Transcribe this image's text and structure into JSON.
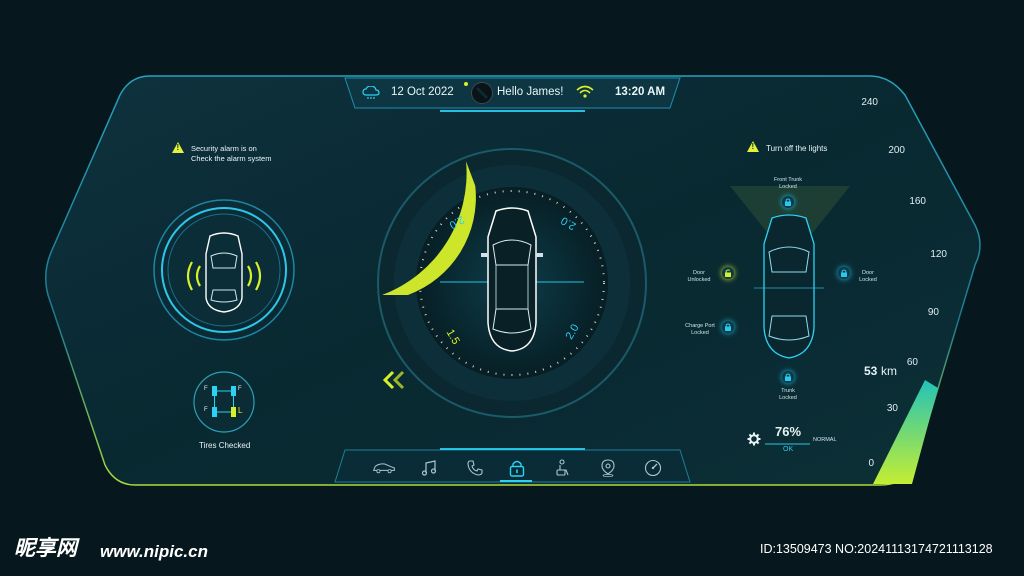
{
  "header": {
    "date": "12 Oct 2022",
    "greeting": "Hello James!",
    "time": "13:20 AM"
  },
  "left_panel": {
    "alarm_line1": "Security alarm is on",
    "alarm_line2": "Check the alarm system",
    "tires_status": "Tires Checked",
    "tire_labels": [
      "F",
      "F",
      "F",
      "L"
    ]
  },
  "center_gauge": {
    "pressure_values": [
      "2.0",
      "2.0",
      "1.5",
      "2.0"
    ],
    "level": 0.35
  },
  "right_panel": {
    "lights_warning": "Turn off the lights",
    "front_trunk": {
      "line1": "Front Trunk",
      "line2": "Locked"
    },
    "door_left": {
      "line1": "Door",
      "line2": "Unlocked"
    },
    "door_right": {
      "line1": "Door",
      "line2": "Locked"
    },
    "charge_port": {
      "line1": "Charge Port",
      "line2": "Locked"
    },
    "trunk": {
      "line1": "Trunk",
      "line2": "Locked"
    },
    "battery_percent": "76%",
    "battery_status": "OK",
    "battery_mode": "NORMAL"
  },
  "speedometer": {
    "ticks": [
      "240",
      "200",
      "160",
      "120",
      "90",
      "60",
      "30",
      "0"
    ],
    "current_value": "53",
    "current_unit": "km"
  },
  "nav": {
    "icons": [
      "car-icon",
      "music-icon",
      "phone-icon",
      "lock-icon",
      "seat-icon",
      "location-icon",
      "gauge-icon"
    ],
    "active": "lock-icon"
  },
  "watermark": {
    "site_logo": "昵享网",
    "site_url": "www.nipic.cn",
    "id_text": "ID:13509473 NO:20241113174721113128"
  },
  "colors": {
    "accent_cyan": "#29c9ee",
    "accent_lime": "#d8f02a",
    "panel": "#0b2a33",
    "background": "#06181d"
  }
}
